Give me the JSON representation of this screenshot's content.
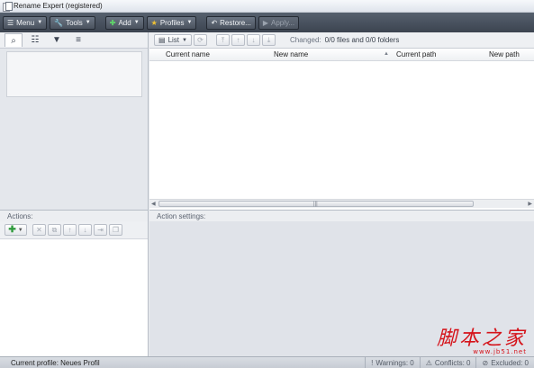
{
  "window": {
    "title": "Rename Expert (registered)"
  },
  "toolbar": {
    "menu_label": "Menu",
    "tools_label": "Tools",
    "add_label": "Add",
    "profiles_label": "Profiles",
    "restore_label": "Restore...",
    "apply_label": "Apply..."
  },
  "file_list": {
    "view_label": "List",
    "changed_label": "Changed:",
    "changed_value": "0/0 files and 0/0 folders",
    "columns": [
      "Current name",
      "New name",
      "Current path",
      "New path"
    ]
  },
  "actions": {
    "header": "Actions:"
  },
  "settings": {
    "header": "Action settings:"
  },
  "status": {
    "profile": "Current profile: Neues Profil",
    "warnings": "Warnings: 0",
    "conflicts": "Conflicts: 0",
    "excluded": "Excluded: 0"
  },
  "watermark": {
    "chinese": "脚本之家",
    "url": "www.jb51.net"
  },
  "colors": {
    "accent_green": "#2f9a3d",
    "toolbar_dark": "#3c4450",
    "watermark_red": "#d5131a"
  }
}
